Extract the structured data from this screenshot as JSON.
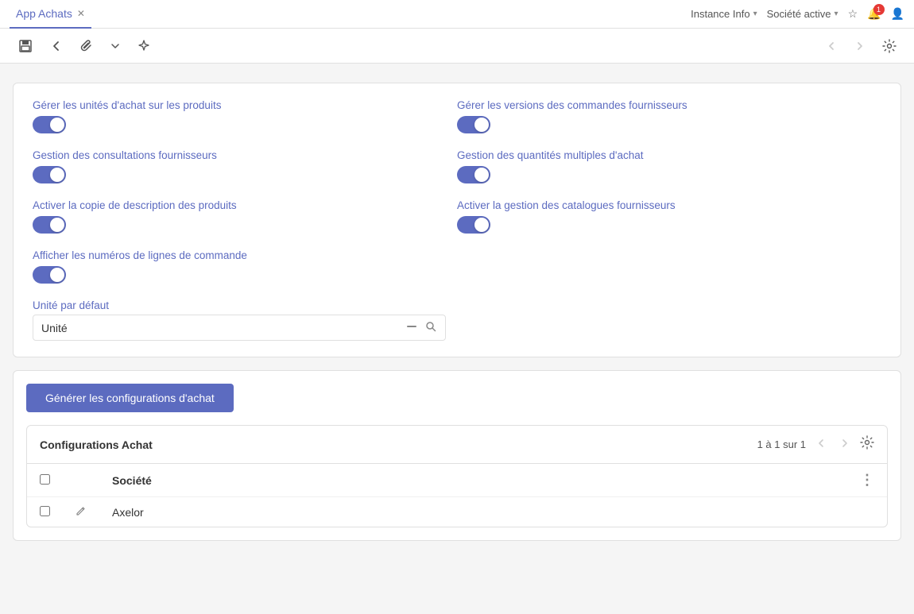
{
  "topbar": {
    "tab_label": "App Achats",
    "instance_info": "Instance Info",
    "societe_active": "Société active",
    "star_icon": "★",
    "bell_count": "1"
  },
  "toolbar": {
    "save_icon": "⊟",
    "back_icon": "←",
    "attach_icon": "🖇",
    "dropdown_icon": "▾",
    "magic_icon": "✳"
  },
  "settings": {
    "col1": [
      {
        "id": "s1",
        "label": "Gérer les unités d'achat sur les produits",
        "checked": true
      },
      {
        "id": "s2",
        "label": "Gestion des consultations fournisseurs",
        "checked": true
      },
      {
        "id": "s3",
        "label": "Activer la copie de description des produits",
        "checked": true
      },
      {
        "id": "s4",
        "label": "Afficher les numéros de lignes de commande",
        "checked": true
      }
    ],
    "col2": [
      {
        "id": "s5",
        "label": "Gérer les versions des commandes fournisseurs",
        "checked": true
      },
      {
        "id": "s6",
        "label": "Gestion des quantités multiples d'achat",
        "checked": true
      },
      {
        "id": "s7",
        "label": "Activer la gestion des catalogues fournisseurs",
        "checked": true
      }
    ],
    "unit_label": "Unité par défaut",
    "unit_value": "Unité"
  },
  "generate_btn": "Générer les configurations d'achat",
  "table": {
    "title": "Configurations Achat",
    "pagination": "1 à 1 sur 1",
    "col_societe": "Société",
    "rows": [
      {
        "id": 1,
        "societe": "Axelor"
      }
    ]
  }
}
